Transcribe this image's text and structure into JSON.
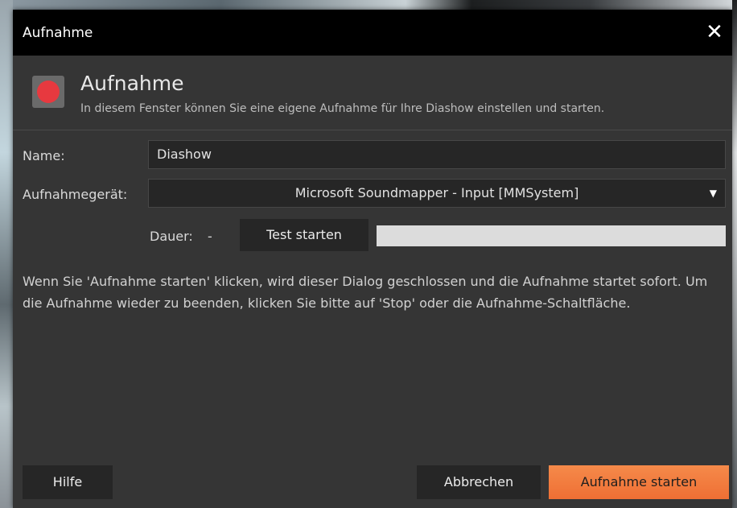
{
  "window": {
    "title": "Aufnahme",
    "close_symbol": "✕"
  },
  "header": {
    "title": "Aufnahme",
    "subtitle": "In diesem Fenster können Sie eine eigene Aufnahme für Ihre Diashow einstellen und starten."
  },
  "form": {
    "name_label": "Name:",
    "name_value": "Diashow",
    "device_label": "Aufnahmegerät:",
    "device_value": "Microsoft Soundmapper - Input [MMSystem]",
    "duration_label": "Dauer:",
    "duration_value": "-",
    "test_button": "Test starten",
    "level_fraction": 0
  },
  "info_text": "Wenn Sie 'Aufnahme starten' klicken, wird dieser Dialog geschlossen und die Aufnahme startet sofort. Um die Aufnahme wieder zu beenden, klicken Sie bitte auf 'Stop' oder die Aufnahme-Schaltfläche.",
  "footer": {
    "help_button": "Hilfe",
    "cancel_button": "Abbrechen",
    "start_button": "Aufnahme starten"
  },
  "colors": {
    "accent": "#ef6f34",
    "record_dot": "#e7393f",
    "dialog_bg": "#353535",
    "titlebar_bg": "#000000"
  },
  "icons": {
    "record": "record-icon",
    "close": "close-icon",
    "dropdown": "chevron-down-icon"
  }
}
